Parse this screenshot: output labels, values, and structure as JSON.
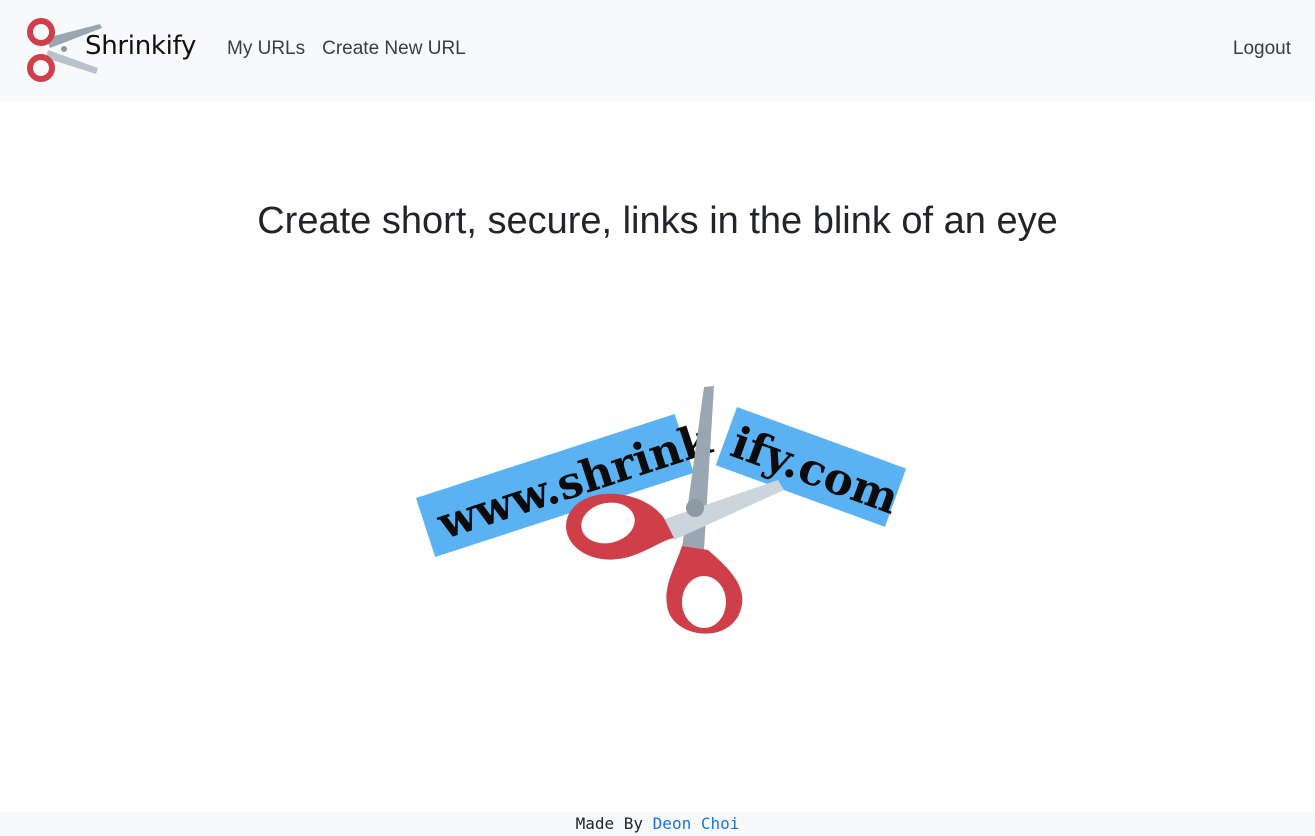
{
  "header": {
    "brand_name": "Shrinkify",
    "nav": {
      "my_urls": "My URLs",
      "create_new_url": "Create New URL"
    },
    "logout": "Logout"
  },
  "main": {
    "headline": "Create short, secure, links in the blink of an eye",
    "hero": {
      "left_tag": "www.shrink",
      "right_tag": "ify.com"
    }
  },
  "footer": {
    "prefix": "Made By ",
    "author": "Deon Choi"
  },
  "colors": {
    "navbar_bg": "#f8f9fa",
    "scissor_red": "#cf3f4a",
    "scissor_blade": "#9aa6b1",
    "tag_blue": "#5ab2f2",
    "link_blue": "#1a73e8"
  }
}
